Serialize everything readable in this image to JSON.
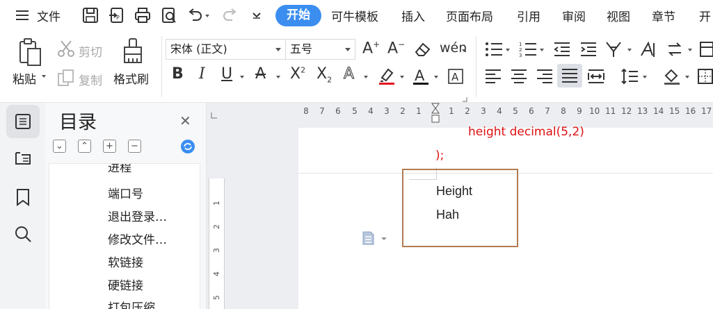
{
  "menubar": {
    "file_label": "文件",
    "tabs": [
      "开始",
      "可牛模板",
      "插入",
      "页面布局",
      "引用",
      "审阅",
      "视图",
      "章节",
      "开"
    ],
    "active_tab": "开始",
    "accent_color": "#3b8ef0"
  },
  "ribbon": {
    "paste_label": "粘贴",
    "cut_label": "剪切",
    "copy_label": "复制",
    "format_painter_label": "格式刷",
    "font_name": "宋体 (正文)",
    "font_size": "五号"
  },
  "toc": {
    "title": "目录",
    "items": [
      "进程",
      "端口号",
      "退出登录…",
      "修改文件…",
      "软链接",
      "硬链接",
      "打包压缩"
    ]
  },
  "ruler": {
    "left_ticks": [
      "8",
      "7",
      "6",
      "5",
      "4",
      "3",
      "2",
      "1"
    ],
    "right_ticks": [
      "1",
      "2",
      "3",
      "4",
      "5",
      "6",
      "7",
      "8",
      "9",
      "10",
      "11",
      "12",
      "13",
      "14",
      "15",
      "16",
      "17"
    ],
    "vertical_ticks": [
      "1",
      "2",
      "3",
      "4",
      "5"
    ]
  },
  "document": {
    "code_lines": [
      "height decimal(5,2)",
      ");"
    ],
    "body_lines": [
      "Height",
      "Hah"
    ],
    "code_color": "#dd1111",
    "box_color": "#b37a52"
  }
}
